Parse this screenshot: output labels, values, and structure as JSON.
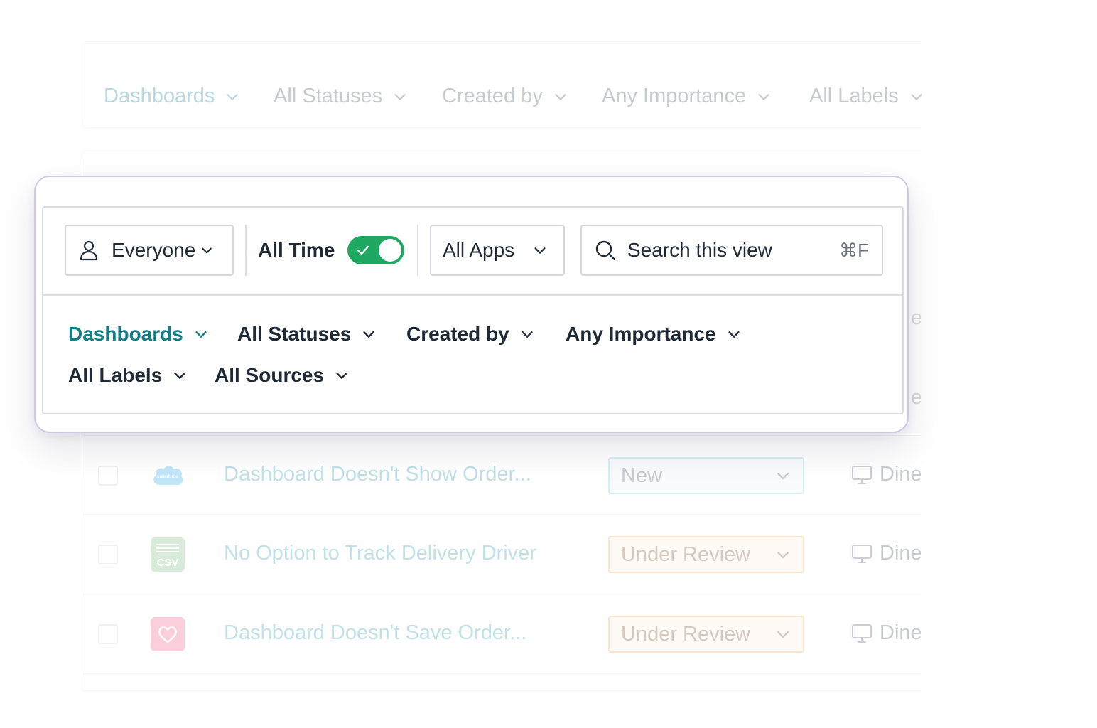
{
  "background": {
    "filters": [
      {
        "label": "Dashboards",
        "active": true
      },
      {
        "label": "All Statuses",
        "active": false
      },
      {
        "label": "Created by",
        "active": false
      },
      {
        "label": "Any Importance",
        "active": false
      },
      {
        "label": "All Labels",
        "active": false
      }
    ],
    "peek_text": [
      "e",
      "e"
    ],
    "rows": [
      {
        "source_icon": "salesforce-icon",
        "source_text": "salesforce",
        "title": "Dashboard Doesn't Show Order...",
        "status": "New",
        "device": "Dine"
      },
      {
        "source_icon": "csv-icon",
        "source_text": "CSV",
        "title": "No Option to Track Delivery Driver",
        "status": "Under Review",
        "device": "Dine"
      },
      {
        "source_icon": "heart-icon",
        "source_text": "",
        "title": "Dashboard Doesn't Save Order...",
        "status": "Under Review",
        "device": "Dine"
      }
    ]
  },
  "card": {
    "everyone_label": "Everyone",
    "all_time_label": "All Time",
    "all_time_enabled": true,
    "apps_label": "All Apps",
    "search_placeholder": "Search this view",
    "search_shortcut": "⌘F",
    "filters": [
      {
        "label": "Dashboards",
        "active": true
      },
      {
        "label": "All Statuses",
        "active": false
      },
      {
        "label": "Created by",
        "active": false
      },
      {
        "label": "Any Importance",
        "active": false
      },
      {
        "label": "All Labels",
        "active": false
      },
      {
        "label": "All Sources",
        "active": false
      }
    ]
  },
  "colors": {
    "accent_teal": "#137e86",
    "toggle_green": "#1ea862",
    "card_border": "#cfc9e6",
    "status_new_border": "#b6e2ee",
    "status_review_border": "#f6cfa3",
    "salesforce_blue": "#8fd3f2",
    "csv_green": "#b9dcb9",
    "heart_pink": "#f7a7bd"
  }
}
